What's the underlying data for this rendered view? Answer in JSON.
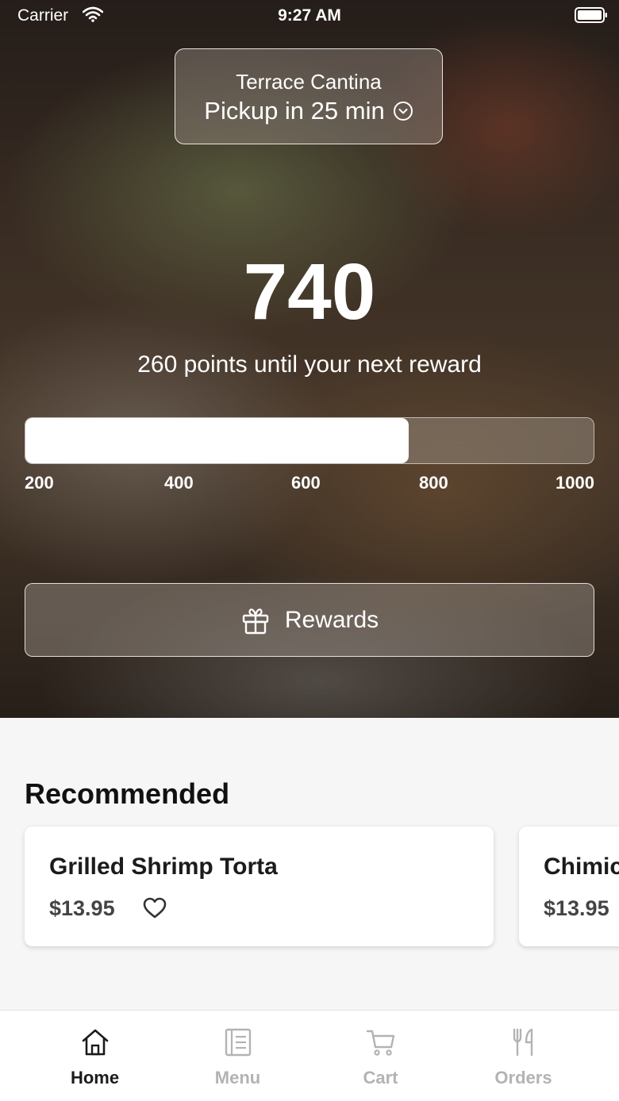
{
  "status_bar": {
    "carrier": "Carrier",
    "time": "9:27 AM",
    "icons": [
      "wifi-icon",
      "battery-icon"
    ]
  },
  "location": {
    "name": "Terrace Cantina",
    "pickup": "Pickup in 25 min",
    "icon": "chevron-down-circle-icon"
  },
  "loyalty": {
    "points": "740",
    "message": "260 points until your next reward",
    "progress_value": 740,
    "progress_min": 200,
    "progress_max": 1000,
    "ticks": [
      "200",
      "400",
      "600",
      "800",
      "1000"
    ]
  },
  "rewards_button": {
    "label": "Rewards",
    "icon": "gift-icon"
  },
  "recommended": {
    "title": "Recommended",
    "items": [
      {
        "name": "Grilled Shrimp Torta",
        "price": "$13.95",
        "favorite_icon": "heart-icon"
      },
      {
        "name": "Chimic",
        "price": "$13.95"
      }
    ]
  },
  "tab_bar": {
    "active": "Home",
    "active_color": "#1b1b1b",
    "inactive_color": "#b3b3b3",
    "tabs": [
      {
        "label": "Home",
        "icon": "home-icon"
      },
      {
        "label": "Menu",
        "icon": "menu-icon"
      },
      {
        "label": "Cart",
        "icon": "cart-icon"
      },
      {
        "label": "Orders",
        "icon": "utensils-icon"
      }
    ]
  }
}
